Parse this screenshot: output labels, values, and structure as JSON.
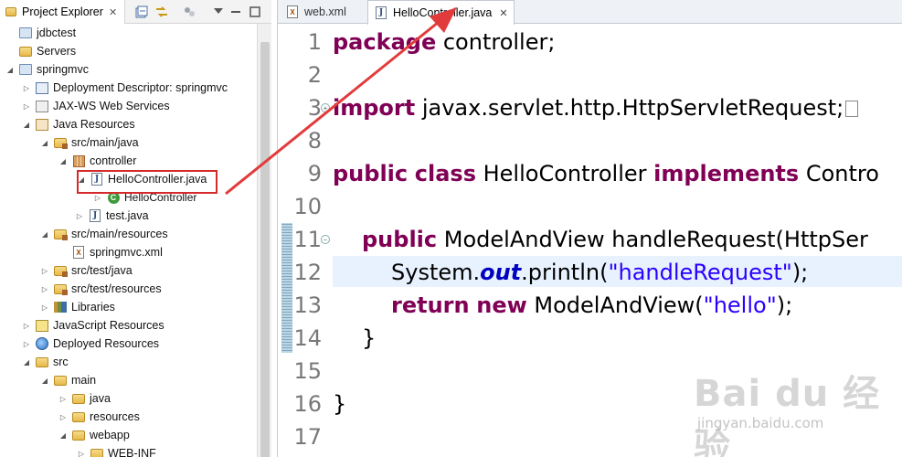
{
  "explorer": {
    "tab_label": "Project Explorer",
    "close_glyph": "✕",
    "tree": [
      {
        "label": "jdbctest",
        "icon": "project-icon"
      },
      {
        "label": "Servers",
        "icon": "folder-icon"
      },
      {
        "label": "springmvc",
        "icon": "project-icon"
      },
      {
        "label": "Deployment Descriptor: springmvc",
        "icon": "deployment-descriptor-icon"
      },
      {
        "label": "JAX-WS Web Services",
        "icon": "web-services-icon"
      },
      {
        "label": "Java Resources",
        "icon": "java-resources-icon"
      },
      {
        "label": "src/main/java",
        "icon": "source-folder-icon"
      },
      {
        "label": "controller",
        "icon": "package-icon"
      },
      {
        "label": "HelloController.java",
        "icon": "java-file-icon"
      },
      {
        "label": "HelloController",
        "icon": "class-icon"
      },
      {
        "label": "test.java",
        "icon": "java-file-icon"
      },
      {
        "label": "src/main/resources",
        "icon": "source-folder-icon"
      },
      {
        "label": "springmvc.xml",
        "icon": "xml-file-icon"
      },
      {
        "label": "src/test/java",
        "icon": "source-folder-icon"
      },
      {
        "label": "src/test/resources",
        "icon": "source-folder-icon"
      },
      {
        "label": "Libraries",
        "icon": "libraries-icon"
      },
      {
        "label": "JavaScript Resources",
        "icon": "javascript-resources-icon"
      },
      {
        "label": "Deployed Resources",
        "icon": "deployed-resources-icon"
      },
      {
        "label": "src",
        "icon": "folder-icon"
      },
      {
        "label": "main",
        "icon": "folder-icon"
      },
      {
        "label": "java",
        "icon": "folder-icon"
      },
      {
        "label": "resources",
        "icon": "folder-icon"
      },
      {
        "label": "webapp",
        "icon": "folder-icon"
      },
      {
        "label": "WEB-INF",
        "icon": "folder-icon"
      }
    ]
  },
  "editor": {
    "tabs": [
      {
        "label": "web.xml",
        "active": false
      },
      {
        "label": "HelloController.java",
        "active": true
      }
    ],
    "close_glyph": "✕",
    "lines": [
      {
        "num": "1"
      },
      {
        "num": "2"
      },
      {
        "num": "3"
      },
      {
        "num": "8"
      },
      {
        "num": "9"
      },
      {
        "num": "10"
      },
      {
        "num": "11"
      },
      {
        "num": "12"
      },
      {
        "num": "13"
      },
      {
        "num": "14"
      },
      {
        "num": "15"
      },
      {
        "num": "16"
      },
      {
        "num": "17"
      }
    ],
    "code": {
      "l1_kw": "package",
      "l1_rest": " controller;",
      "l3_kw": "import",
      "l3_rest": " javax.servlet.http.HttpServletRequest;",
      "l9_kw1": "public",
      "l9_kw2": "class",
      "l9_name": " HelloController ",
      "l9_kw3": "implements",
      "l9_rest": " Contro",
      "l11_kw": "public",
      "l11_rest": " ModelAndView handleRequest(HttpSer",
      "l12_pre": "System.",
      "l12_field": "out",
      "l12_mid": ".println(",
      "l12_str": "\"handleRequest\"",
      "l12_end": ");",
      "l13_kw1": "return",
      "l13_kw2": "new",
      "l13_mid": " ModelAndView(",
      "l13_str": "\"hello\"",
      "l13_end": ");",
      "l14": "}",
      "l16": "}"
    }
  },
  "colors": {
    "keyword": "#7f0055",
    "string": "#2a00ff",
    "field": "#0000c0",
    "highlight_box": "#d42a2a",
    "arrow": "#e23b3b"
  },
  "watermark": {
    "logo": "Bai du 经验",
    "url": "jingyan.baidu.com"
  }
}
